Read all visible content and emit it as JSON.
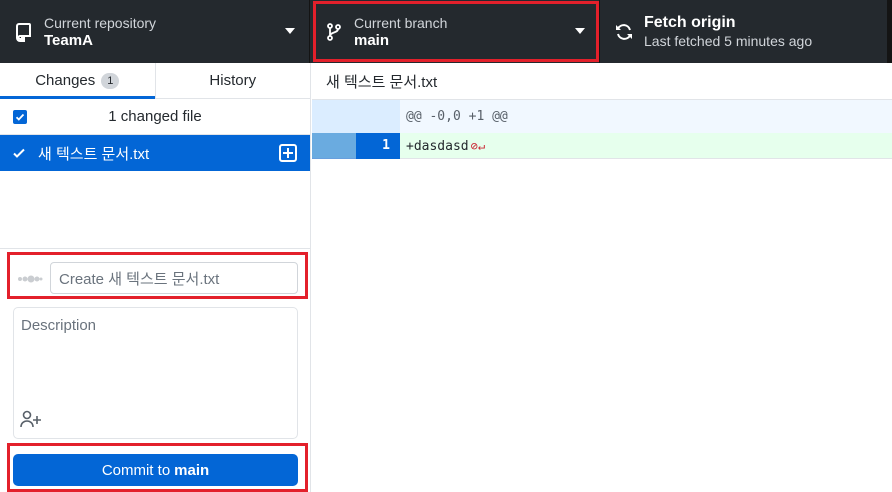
{
  "toolbar": {
    "repository": {
      "label": "Current repository",
      "value": "TeamA"
    },
    "branch": {
      "label": "Current branch",
      "value": "main"
    },
    "fetch": {
      "label": "Fetch origin",
      "sublabel": "Last fetched 5 minutes ago"
    }
  },
  "tabs": {
    "changes": {
      "label": "Changes",
      "count": "1"
    },
    "history": {
      "label": "History"
    }
  },
  "changes": {
    "summary": "1 changed file",
    "files": [
      {
        "name": "새 텍스트 문서.txt",
        "status": "added"
      }
    ]
  },
  "commit": {
    "summary_placeholder": "Create 새 텍스트 문서.txt",
    "description_placeholder": "Description",
    "button_prefix": "Commit to",
    "button_branch": "main"
  },
  "diff": {
    "file_title": "새 텍스트 문서.txt",
    "hunk_header": "@@ -0,0 +1 @@",
    "lines": [
      {
        "new_line_no": "1",
        "text": "+dasdasd"
      }
    ]
  },
  "colors": {
    "toolbar_bg": "#24292e",
    "accent": "#0366d6",
    "added_bg": "#e6ffed",
    "hunk_bg": "#f1f8ff",
    "highlight": "#e3202b"
  }
}
